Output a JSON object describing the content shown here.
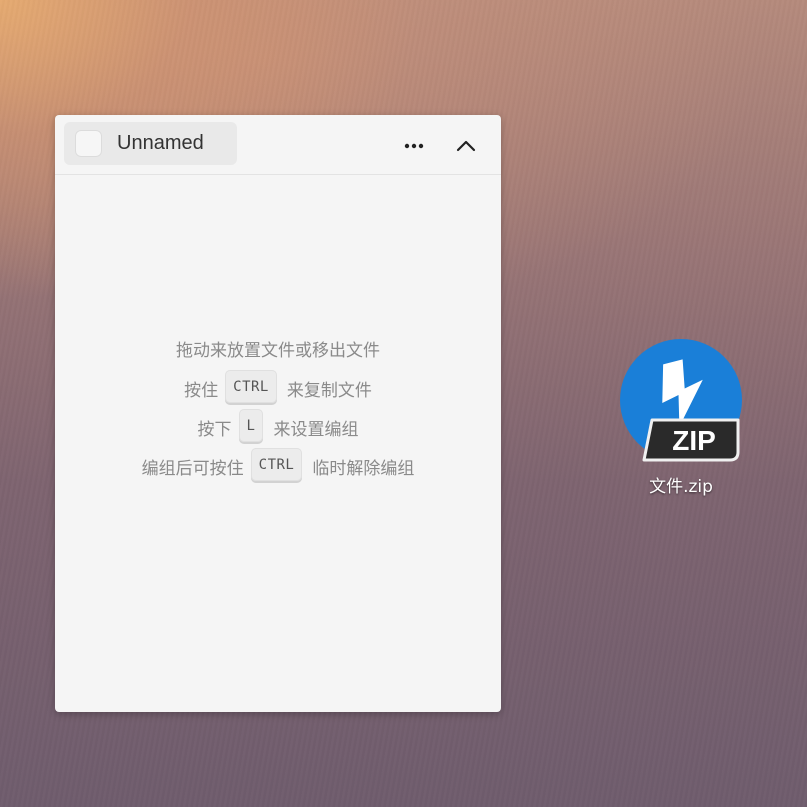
{
  "panel": {
    "group_name": "Unnamed",
    "menu_icon": "more-horizontal-icon",
    "collapse_icon": "chevron-up-icon",
    "hints": [
      {
        "text": "拖动来放置文件或移出文件"
      },
      {
        "before": "按住",
        "key": "CTRL",
        "after": "来复制文件"
      },
      {
        "before": "按下",
        "key": "L",
        "after": "来设置编组"
      },
      {
        "before": "编组后可按住",
        "key": "CTRL",
        "after": "临时解除编组"
      }
    ]
  },
  "desktop": {
    "file": {
      "label": "文件.zip",
      "badge": "ZIP",
      "icon": "zip-archive-icon",
      "accent": "#1a7fd8"
    }
  }
}
